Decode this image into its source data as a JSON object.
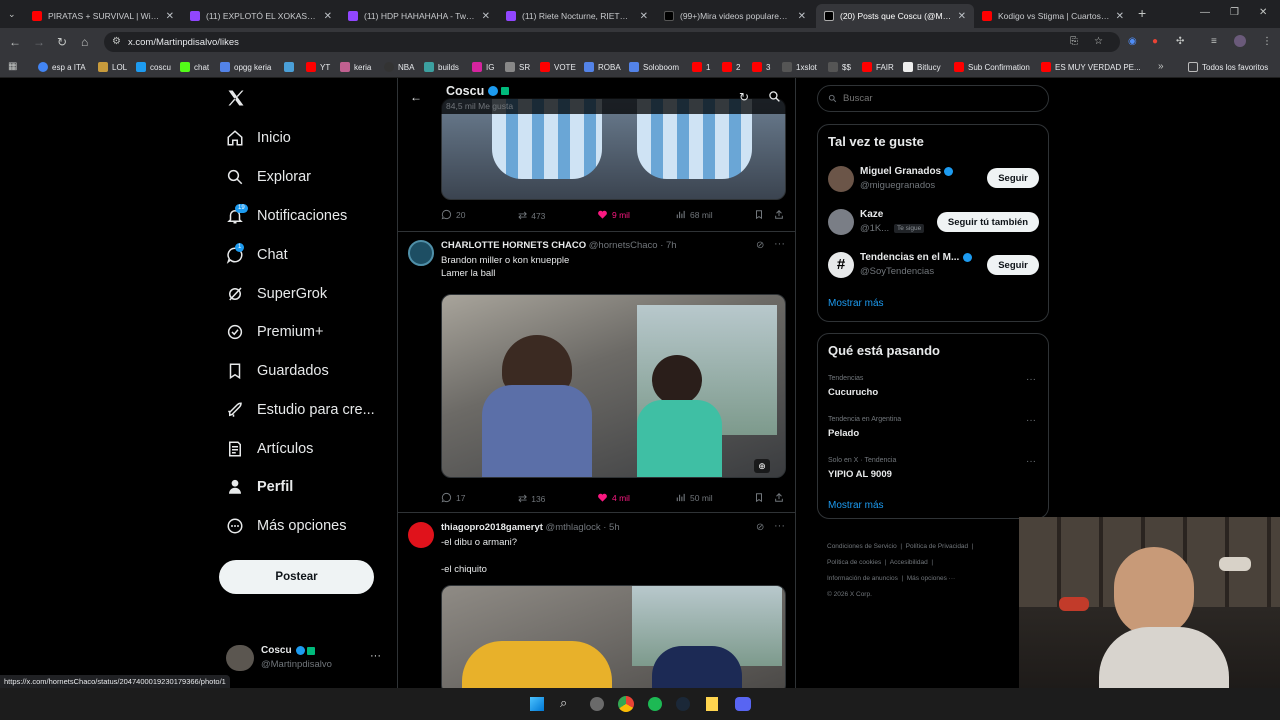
{
  "tabs": [
    {
      "title": "PIRATAS + SURVIVAL | WindRo",
      "color": "#ff0000"
    },
    {
      "title": "(11) EXPLOTÓ EL XOKAS - Twitc",
      "color": "#9146ff"
    },
    {
      "title": "(11) HDP HAHAHAHA - Twitch",
      "color": "#9146ff"
    },
    {
      "title": "(11) Riete Nocturne, RIETE ! xd",
      "color": "#9146ff"
    },
    {
      "title": "(99+)Mira videos populares se",
      "color": "#ffffff"
    },
    {
      "title": "(20) Posts que Coscu (@Martin",
      "color": "#ffffff"
    },
    {
      "title": "Kodigo vs Stigma | Cuartos de",
      "color": "#ff0000"
    }
  ],
  "url": "x.com/Martinpdisalvo/likes",
  "bookmarks": [
    "esp a ITA",
    "LOL",
    "coscu",
    "chat",
    "opgg keria",
    "",
    "YT",
    "keria",
    "NBA",
    "builds",
    "IG",
    "SR",
    "VOTE",
    "ROBA",
    "Soloboom",
    "1",
    "2",
    "3",
    "1xslot",
    "$$",
    "FAIR",
    "Bitlucy",
    "Sub Confirmation",
    "ES MUY VERDAD PE...",
    "Todos los favoritos"
  ],
  "nav": {
    "items": [
      {
        "label": "Inicio",
        "icon": "home-icon"
      },
      {
        "label": "Explorar",
        "icon": "search-icon"
      },
      {
        "label": "Notificaciones",
        "icon": "bell-icon",
        "badge": "19"
      },
      {
        "label": "Chat",
        "icon": "chat-icon",
        "badge": "1"
      },
      {
        "label": "SuperGrok",
        "icon": "grok-icon"
      },
      {
        "label": "Premium+",
        "icon": "premium-icon"
      },
      {
        "label": "Guardados",
        "icon": "bookmark-icon"
      },
      {
        "label": "Estudio para cre...",
        "icon": "rocket-icon"
      },
      {
        "label": "Artículos",
        "icon": "article-icon"
      },
      {
        "label": "Perfil",
        "icon": "person-icon"
      },
      {
        "label": "Más opciones",
        "icon": "more-icon"
      }
    ],
    "post_label": "Postear",
    "account_name": "Coscu",
    "account_handle": "@Martinpdisalvo"
  },
  "header": {
    "name": "Coscu",
    "subtitle": "84,5 mil Me gusta"
  },
  "posts": [
    {
      "stats": {
        "replies": "20",
        "reposts": "473",
        "likes": "9 mil",
        "views": "68 mil"
      }
    },
    {
      "author": "CHARLOTTE HORNETS CHACO",
      "handle": "@hornetsChaco",
      "time": "· 7h",
      "line1": "Brandon miller o kon knuepple",
      "line2": "Lamer la ball",
      "stats": {
        "replies": "17",
        "reposts": "136",
        "likes": "4 mil",
        "views": "50 mil"
      }
    },
    {
      "author": "thiagopro2018gameryt",
      "handle": "@mthlaglock",
      "time": "· 5h",
      "line1": "-el dibu o armani?",
      "line2": "-el chiquito"
    }
  ],
  "search": {
    "placeholder": "Buscar"
  },
  "suggest": {
    "title": "Tal vez te guste",
    "users": [
      {
        "name": "Miguel Granados",
        "handle": "@miguegranados",
        "button": "Seguir"
      },
      {
        "name": "Kaze",
        "handle": "@1K...",
        "tag": "Te sigue",
        "button": "Seguir tú también"
      },
      {
        "name": "Tendencias en el M...",
        "handle": "@SoyTendencias",
        "button": "Seguir"
      }
    ],
    "more": "Mostrar más"
  },
  "trends": {
    "title": "Qué está pasando",
    "items": [
      {
        "context": "Tendencias",
        "name": "Cucurucho"
      },
      {
        "context": "Tendencia en Argentina",
        "name": "Pelado"
      },
      {
        "context": "Solo en X · Tendencia",
        "name": "YIPIO AL 9009"
      }
    ],
    "more": "Mostrar más"
  },
  "footer": [
    "Condiciones de Servicio",
    "Política de Privacidad",
    "Política de cookies",
    "Accesibilidad",
    "Información de anuncios",
    "Más opciones ···",
    "© 2026 X Corp."
  ],
  "status_url": "https://x.com/hornetsChaco/status/2047400019230179366/photo/1"
}
